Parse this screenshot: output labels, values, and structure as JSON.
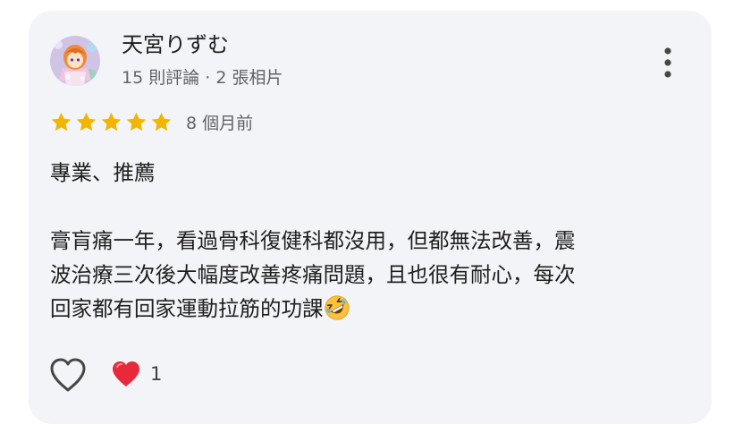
{
  "reviewer": {
    "name": "天宮りずむ",
    "meta": "15 則評論 · 2 張相片"
  },
  "review": {
    "rating": 5,
    "rating_max": 5,
    "date": "8 個月前",
    "paragraph1": "專業、推薦",
    "lines": [
      "膏肓痛一年，看過骨科復健科都沒用，但都無法改善，震",
      "波治療三次後大幅度改善疼痛問題，且也很有耐心，每次",
      "回家都有回家運動拉筋的功課"
    ]
  },
  "icons": {
    "more": "more-vert-icon",
    "like": "heart-outline-icon",
    "reaction": "red-heart-emoji",
    "emoji": "rolling-on-floor-laughing-emoji"
  },
  "reactions": {
    "heart_count": "1"
  },
  "colors": {
    "card_background": "#f3f4f7",
    "star": "#f2b500",
    "heart": "#e8293b",
    "text_primary": "#1f1f1f",
    "text_secondary": "#5f6368"
  }
}
